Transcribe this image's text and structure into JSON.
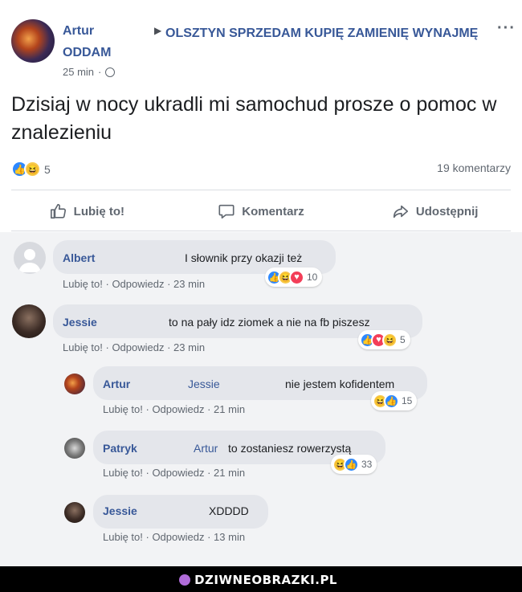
{
  "post": {
    "author": "Artur",
    "group": "OLSZTYN SPRZEDAM KUPIĘ ZAMIENIĘ WYNAJMĘ ODDAM",
    "time": "25 min",
    "text": "Dzisiaj w nocy ukradli mi samochud prosze o pomoc w znalezieniu",
    "reaction_count": "5",
    "comments_count": "19 komentarzy"
  },
  "actions": {
    "like": "Lubię to!",
    "comment": "Komentarz",
    "share": "Udostępnij"
  },
  "comments": [
    {
      "name": "Albert",
      "mention": "",
      "text": "I słownik przy okazji też",
      "like": "Lubię to!",
      "reply": "Odpowiedz",
      "time": "23 min",
      "reactions": "10"
    },
    {
      "name": "Jessie",
      "mention": "",
      "text": "to na pały idz ziomek a nie na fb piszesz",
      "like": "Lubię to!",
      "reply": "Odpowiedz",
      "time": "23 min",
      "reactions": "5"
    },
    {
      "name": "Artur",
      "mention": "Jessie",
      "text": "nie jestem kofidentem",
      "like": "Lubię to!",
      "reply": "Odpowiedz",
      "time": "21 min",
      "reactions": "15"
    },
    {
      "name": "Patryk",
      "mention": "Artur",
      "text": "to zostaniesz rowerzystą",
      "like": "Lubię to!",
      "reply": "Odpowiedz",
      "time": "21 min",
      "reactions": "33"
    },
    {
      "name": "Jessie",
      "mention": "",
      "text": "XDDDD",
      "like": "Lubię to!",
      "reply": "Odpowiedz",
      "time": "13 min",
      "reactions": ""
    }
  ],
  "watermark": "DZIWNEOBRAZKI.PL",
  "colors": {
    "link": "#385898",
    "like_blue": "#2d88ff",
    "love_red": "#f33e58",
    "haha_yellow": "#f7c94a"
  }
}
